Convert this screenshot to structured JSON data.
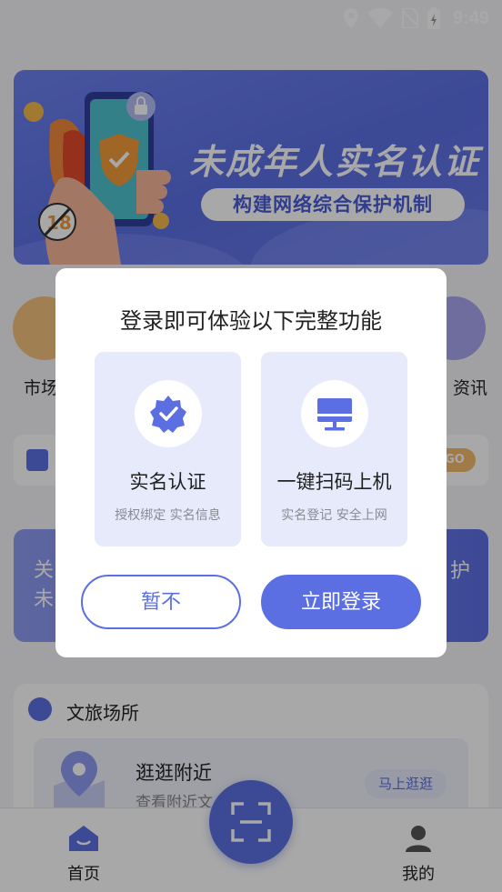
{
  "status_bar": {
    "time": "9:49",
    "icons": [
      "location-icon",
      "wifi-icon",
      "no-sim-icon",
      "battery-charging-icon"
    ]
  },
  "banner": {
    "title": "未成年人实名认证",
    "subtitle": "构建网络综合保护机制",
    "badge_text": "18"
  },
  "quick_menu": {
    "left_label_partial": "市场",
    "right_label_partial": "资讯"
  },
  "notice": {
    "go_label": "GO"
  },
  "promo": {
    "left_line1": "关",
    "left_line2": "未",
    "right_text": "护"
  },
  "venue": {
    "section_title": "文旅场所",
    "item_name": "逛逛附近",
    "item_desc": "查看附近文",
    "item_button": "马上逛逛"
  },
  "bottom_nav": {
    "home_label": "首页",
    "mine_label": "我的"
  },
  "dialog": {
    "title": "登录即可体验以下完整功能",
    "features": [
      {
        "title": "实名认证",
        "desc": "授权绑定 实名信息",
        "icon": "verified-badge-icon"
      },
      {
        "title": "一键扫码上机",
        "desc": "实名登记 安全上网",
        "icon": "computer-icon"
      }
    ],
    "cancel_label": "暂不",
    "login_label": "立即登录"
  },
  "colors": {
    "accent": "#5b6fe3",
    "feature_card_bg": "#e6eafb",
    "overlay": "rgba(0,0,0,0.34)"
  }
}
